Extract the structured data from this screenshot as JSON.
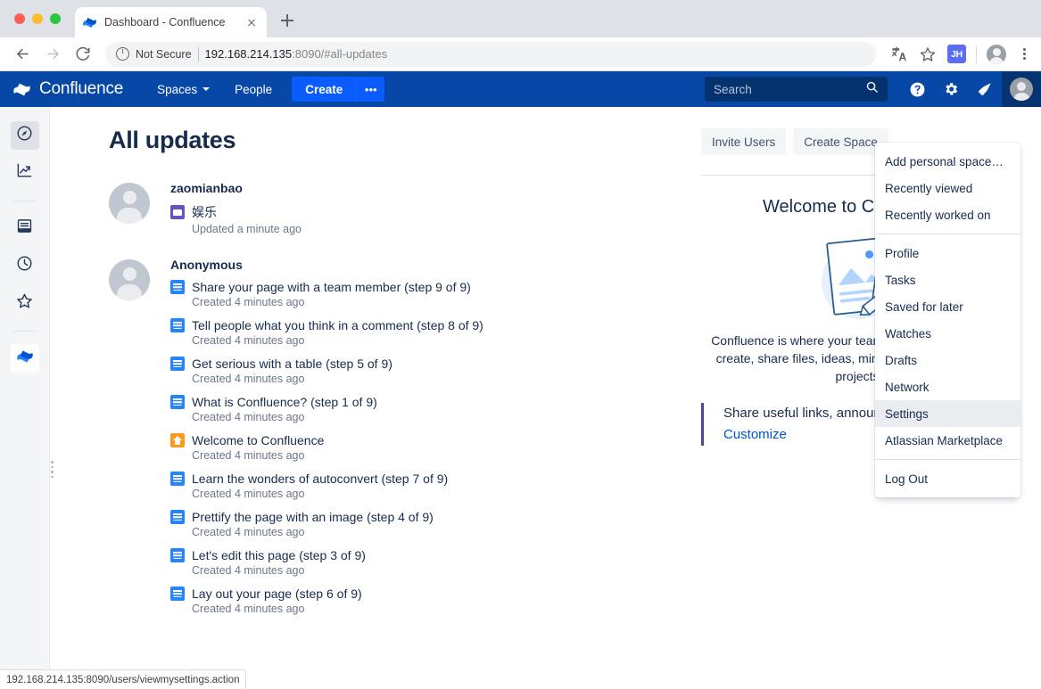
{
  "browser": {
    "tab": {
      "title": "Dashboard - Confluence",
      "favicon": "confluence-favicon"
    },
    "new_tab_label": "+",
    "security_label": "Not Secure",
    "url_host": "192.168.214.135",
    "url_rest": ":8090/#all-updates",
    "icons": {
      "back": "back-arrow-icon",
      "forward": "forward-arrow-icon",
      "reload": "reload-icon",
      "translate": "translate-icon",
      "bookmark": "star-icon",
      "extension": "JH",
      "profile": "profile-avatar-icon",
      "menu": "kebab-menu-icon"
    },
    "status_bar_url": "192.168.214.135:8090/users/viewmysettings.action"
  },
  "confluence_header": {
    "logo_text": "Confluence",
    "nav": [
      {
        "label": "Spaces",
        "has_caret": true
      },
      {
        "label": "People",
        "has_caret": false
      }
    ],
    "create_label": "Create",
    "create_more_label": "•••",
    "search_placeholder": "Search",
    "icons": [
      "help-icon",
      "settings-gear-icon",
      "notifications-icon",
      "user-avatar-icon"
    ],
    "colors": {
      "header_bg": "#0747A6",
      "create_btn": "#0B5CFF",
      "search_bg": "#04326e"
    }
  },
  "sidebar": {
    "items": [
      {
        "name": "discover",
        "icon": "compass-icon",
        "active": true
      },
      {
        "name": "analytics",
        "icon": "chart-trend-icon",
        "active": false
      },
      {
        "name": "feed",
        "icon": "inbox-icon",
        "active": false
      },
      {
        "name": "recent",
        "icon": "clock-icon",
        "active": false
      },
      {
        "name": "starred",
        "icon": "star-outline-icon",
        "active": false
      },
      {
        "name": "confluence-app",
        "icon": "confluence-logo-icon",
        "active": false
      }
    ],
    "expand_label": "»"
  },
  "main": {
    "page_title": "All updates",
    "groups": [
      {
        "author": "zaomianbao",
        "entries": [
          {
            "icon": "space-icon",
            "title": "娱乐",
            "meta": "Updated a minute ago"
          }
        ]
      },
      {
        "author": "Anonymous",
        "entries": [
          {
            "icon": "page-icon",
            "title": "Share your page with a team member (step 9 of 9)",
            "meta": "Created 4 minutes ago"
          },
          {
            "icon": "page-icon",
            "title": "Tell people what you think in a comment (step 8 of 9)",
            "meta": "Created 4 minutes ago"
          },
          {
            "icon": "page-icon",
            "title": "Get serious with a table (step 5 of 9)",
            "meta": "Created 4 minutes ago"
          },
          {
            "icon": "page-icon",
            "title": "What is Confluence? (step 1 of 9)",
            "meta": "Created 4 minutes ago"
          },
          {
            "icon": "home-icon",
            "title": "Welcome to Confluence",
            "meta": "Created 4 minutes ago"
          },
          {
            "icon": "page-icon",
            "title": "Learn the wonders of autoconvert (step 7 of 9)",
            "meta": "Created 4 minutes ago"
          },
          {
            "icon": "page-icon",
            "title": "Prettify the page with an image (step 4 of 9)",
            "meta": "Created 4 minutes ago"
          },
          {
            "icon": "page-icon",
            "title": "Let's edit this page (step 3 of 9)",
            "meta": "Created 4 minutes ago"
          },
          {
            "icon": "page-icon",
            "title": "Lay out your page (step 6 of 9)",
            "meta": "Created 4 minutes ago"
          }
        ]
      }
    ]
  },
  "right_panel": {
    "buttons": [
      {
        "label": "Invite Users"
      },
      {
        "label": "Create Space"
      }
    ],
    "heading": "Welcome to Confluence",
    "description": "Confluence is where your team shares knowledge — create, share files, ideas, minutes, specs, mockups projects",
    "quote_text": "Share useful links, announcements here",
    "quote_link": "Customize",
    "quote_accent": "#5243AA"
  },
  "dropdown": {
    "sections": [
      {
        "items": [
          {
            "label": "Add personal space…",
            "hover": false
          },
          {
            "label": "Recently viewed",
            "hover": false
          },
          {
            "label": "Recently worked on",
            "hover": false
          }
        ]
      },
      {
        "items": [
          {
            "label": "Profile",
            "hover": false
          },
          {
            "label": "Tasks",
            "hover": false
          },
          {
            "label": "Saved for later",
            "hover": false
          },
          {
            "label": "Watches",
            "hover": false
          },
          {
            "label": "Drafts",
            "hover": false
          },
          {
            "label": "Network",
            "hover": false
          },
          {
            "label": "Settings",
            "hover": true
          },
          {
            "label": "Atlassian Marketplace",
            "hover": false
          }
        ]
      },
      {
        "items": [
          {
            "label": "Log Out",
            "hover": false
          }
        ]
      }
    ]
  }
}
